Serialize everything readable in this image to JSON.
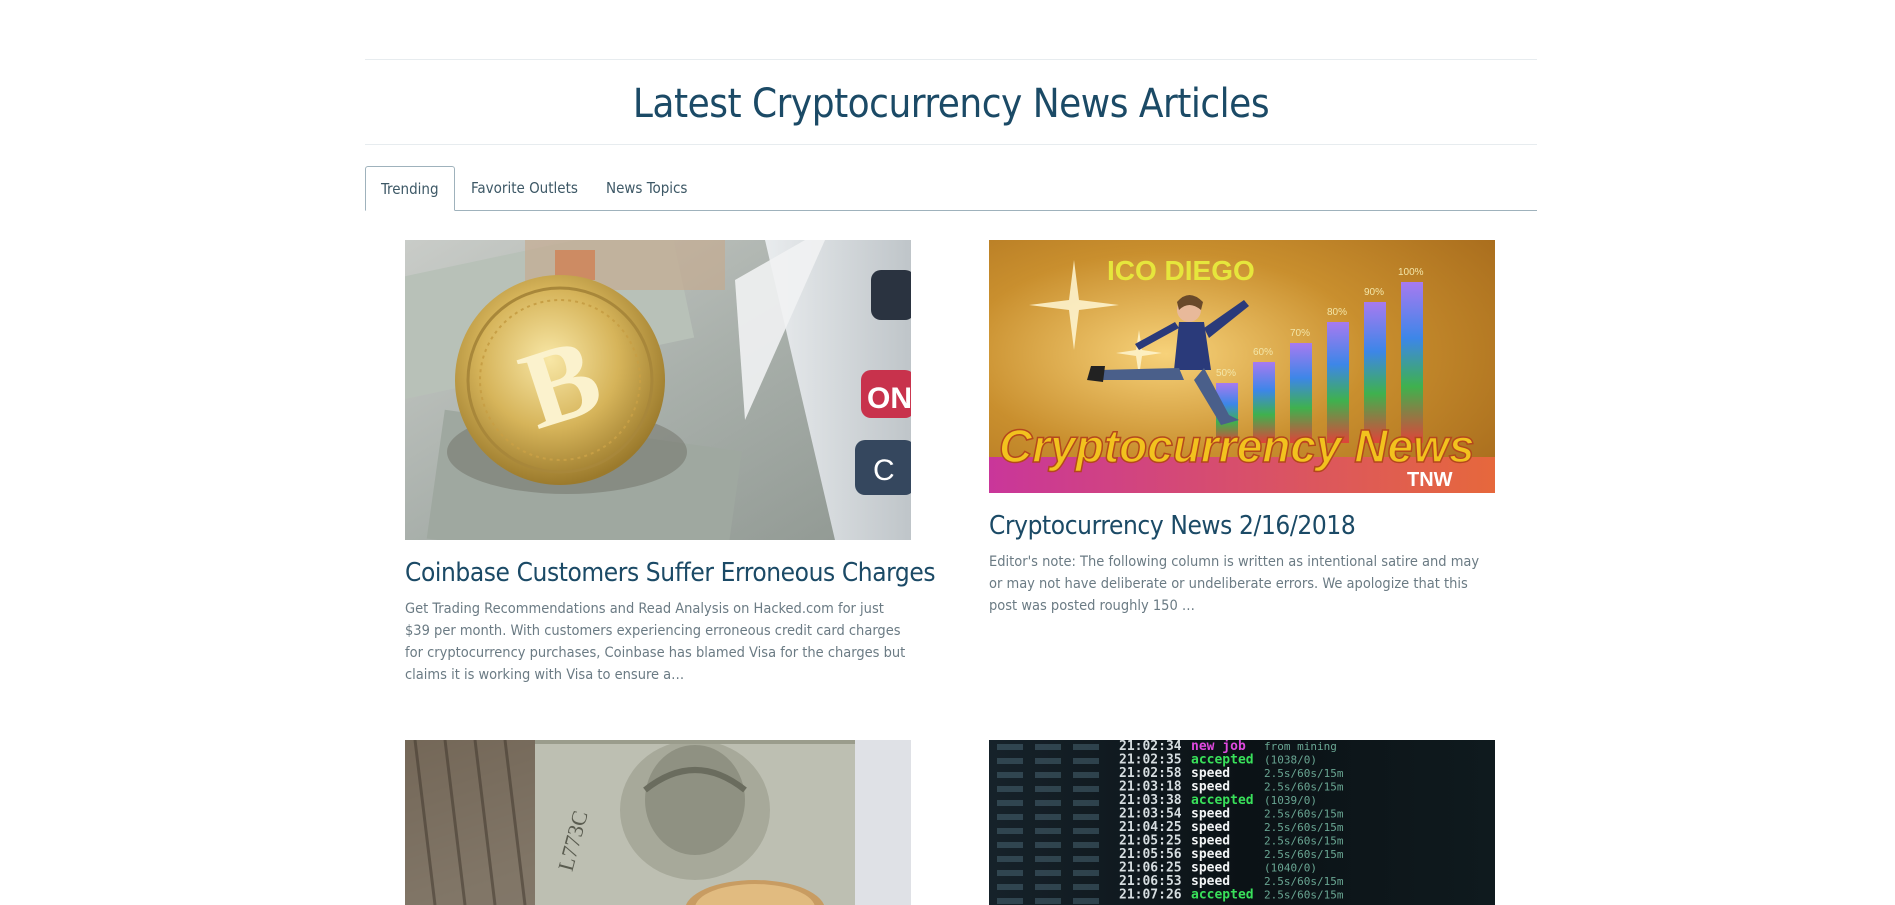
{
  "page": {
    "title": "Latest Cryptocurrency News Articles"
  },
  "tabs": [
    {
      "label": "Trending",
      "active": true
    },
    {
      "label": "Favorite Outlets",
      "active": false
    },
    {
      "label": "News Topics",
      "active": false
    }
  ],
  "articles": [
    {
      "title": "Coinbase Customers Suffer Erroneous Charges",
      "excerpt": "Get Trading Recommendations and Read Analysis on Hacked.com for just $39 per month. With customers experiencing erroneous credit card charges for cryptocurrency purchases, Coinbase has blamed Visa for the charges but claims it is working with Visa to ensure a…",
      "image": "bitcoin-coin-on-dollars-with-calculator",
      "image_text": {
        "key_on": "ON",
        "key_c": "C",
        "coin_letter": "B"
      }
    },
    {
      "title": "Cryptocurrency News 2/16/2018",
      "excerpt": "Editor's note: The following column is written as intentional satire and may or may not have deliberate or undeliberate errors.  We apologize that this post was posted roughly 150 …",
      "image": "ico-diego-cryptocurrency-news-banner",
      "image_text": {
        "headline": "ICO DIEGO",
        "banner": "Cryptocurrency News",
        "logo": "TNW",
        "bars": [
          "50%",
          "60%",
          "70%",
          "80%",
          "90%",
          "100%"
        ]
      }
    },
    {
      "title": "",
      "excerpt": "",
      "image": "dollar-bills-with-coin"
    },
    {
      "title": "",
      "excerpt": "",
      "image": "mining-terminal-output",
      "image_text": {
        "lines": [
          {
            "time": "21:02:34",
            "word": "new job",
            "rest": "from mining"
          },
          {
            "time": "21:02:35",
            "word": "accepted",
            "rest": "(1038/0)"
          },
          {
            "time": "21:02:58",
            "word": "speed",
            "rest": "2.5s/60s/15m"
          },
          {
            "time": "21:03:18",
            "word": "speed",
            "rest": "2.5s/60s/15m"
          },
          {
            "time": "21:03:38",
            "word": "accepted",
            "rest": "(1039/0)"
          },
          {
            "time": "21:03:54",
            "word": "speed",
            "rest": "2.5s/60s/15m"
          },
          {
            "time": "21:04:25",
            "word": "speed",
            "rest": "2.5s/60s/15m"
          },
          {
            "time": "21:05:25",
            "word": "speed",
            "rest": "2.5s/60s/15m"
          },
          {
            "time": "21:05:56",
            "word": "speed",
            "rest": "2.5s/60s/15m"
          },
          {
            "time": "21:06:25",
            "word": "speed",
            "rest": "(1040/0)"
          },
          {
            "time": "21:06:53",
            "word": "speed",
            "rest": "2.5s/60s/15m"
          },
          {
            "time": "21:07:26",
            "word": "accepted",
            "rest": "2.5s/60s/15m"
          }
        ]
      }
    }
  ],
  "colors": {
    "title": "#1b4a66",
    "text": "#6b7b84",
    "tab_border": "#9fb2bc"
  }
}
